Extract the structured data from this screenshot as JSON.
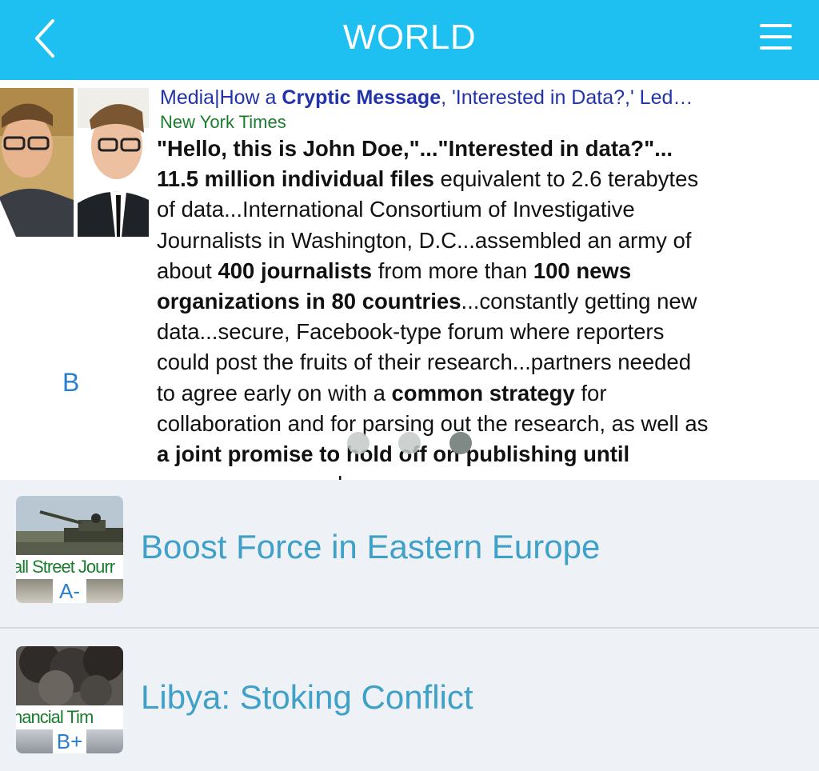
{
  "header": {
    "title": "WORLD",
    "back_icon": "chevron-left-icon",
    "menu_icon": "hamburger-menu-icon",
    "color": "#1ec0f2"
  },
  "featured": {
    "headline_prefix": "Media|How a ",
    "headline_bold": "Cryptic Message",
    "headline_suffix": ", 'Interested in Data?,' Led…",
    "source": "New York Times",
    "grade": "B",
    "body_lines": [
      [
        {
          "t": "\"Hello, this is John Doe,\"...\"Interested in data?\"...",
          "b": true
        }
      ],
      [
        {
          "t": "11.5 million individual files",
          "b": true
        },
        {
          "t": " equivalent to 2.6 terabytes",
          "b": false
        }
      ],
      [
        {
          "t": "of data...International Consortium of Investigative",
          "b": false
        }
      ],
      [
        {
          "t": "Journalists in Washington, D.C...assembled an army of",
          "b": false
        }
      ],
      [
        {
          "t": "about ",
          "b": false
        },
        {
          "t": "400 journalists",
          "b": true
        },
        {
          "t": " from more than ",
          "b": false
        },
        {
          "t": "100 news",
          "b": true
        }
      ],
      [
        {
          "t": "organizations in 80 countries",
          "b": true
        },
        {
          "t": "...constantly getting new",
          "b": false
        }
      ],
      [
        {
          "t": "data...secure, Facebook-type forum where reporters",
          "b": false
        }
      ],
      [
        {
          "t": "could post the fruits of their research...partners needed",
          "b": false
        }
      ],
      [
        {
          "t": "to agree early on with a ",
          "b": false
        },
        {
          "t": "common strategy",
          "b": true
        },
        {
          "t": " for",
          "b": false
        }
      ],
      [
        {
          "t": "collaboration and for parsing out the research, as well as",
          "b": false
        }
      ],
      [
        {
          "t": "a joint promise to hold off on publishing until",
          "b": true
        }
      ],
      [
        {
          "t": "everyone was ready",
          "b": false
        }
      ]
    ],
    "pager": {
      "count": 3,
      "active_index": 2,
      "active_color": "#7f8a86",
      "inactive_color": "#c4c9c8"
    }
  },
  "list": {
    "items": [
      {
        "title": "Boost Force in Eastern Europe",
        "source": "all Street Jourr",
        "grade": "A-"
      },
      {
        "title": "Libya: Stoking Conflict",
        "source": "nancial Tim",
        "grade": "B+"
      }
    ]
  }
}
